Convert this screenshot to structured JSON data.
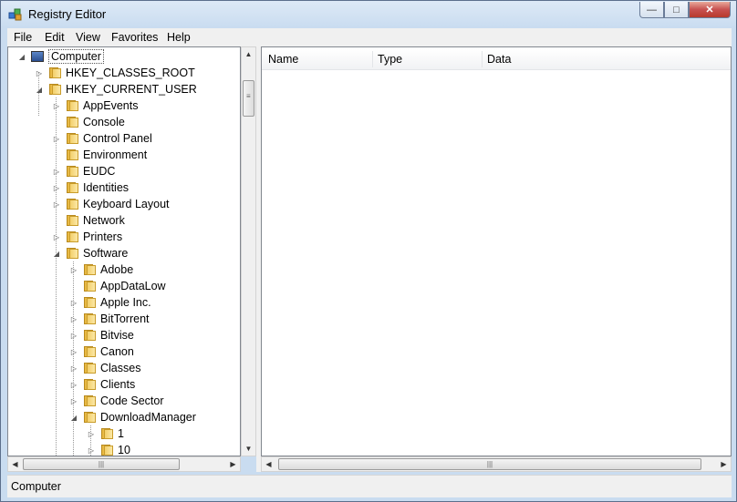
{
  "window": {
    "title": "Registry Editor",
    "minimize": "—",
    "maximize": "□",
    "close": "✕"
  },
  "menu": [
    "File",
    "Edit",
    "View",
    "Favorites",
    "Help"
  ],
  "tree": {
    "root": "Computer",
    "hives": [
      "HKEY_CLASSES_ROOT",
      "HKEY_CURRENT_USER"
    ],
    "hkcu_children": [
      "AppEvents",
      "Console",
      "Control Panel",
      "Environment",
      "EUDC",
      "Identities",
      "Keyboard Layout",
      "Network",
      "Printers",
      "Software"
    ],
    "software_children": [
      "Adobe",
      "AppDataLow",
      "Apple Inc.",
      "BitTorrent",
      "Bitvise",
      "Canon",
      "Classes",
      "Clients",
      "Code Sector",
      "DownloadManager"
    ],
    "downloadmanager_children": [
      "1",
      "10"
    ]
  },
  "list": {
    "columns": [
      "Name",
      "Type",
      "Data"
    ]
  },
  "status": {
    "path": "Computer"
  }
}
